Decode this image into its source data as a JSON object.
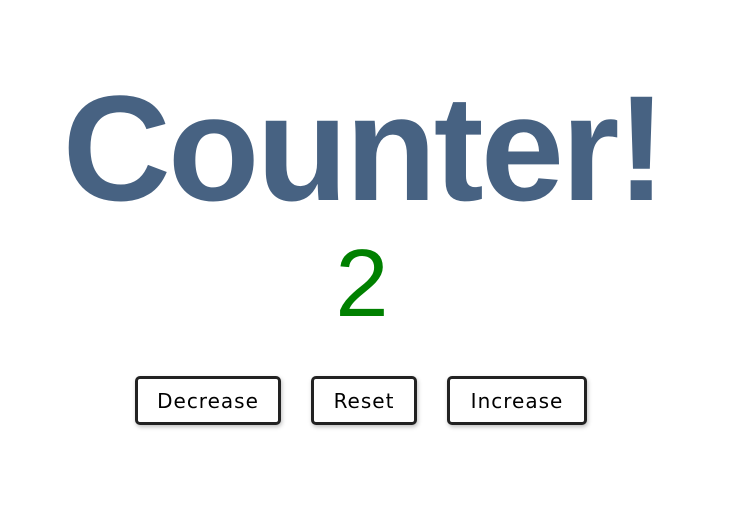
{
  "title": {
    "text": "Counter!",
    "color": "#476282"
  },
  "counter": {
    "value": "2",
    "color": "#008000"
  },
  "buttons": {
    "decrease_label": "Decrease",
    "reset_label": "Reset",
    "increase_label": "Increase"
  }
}
